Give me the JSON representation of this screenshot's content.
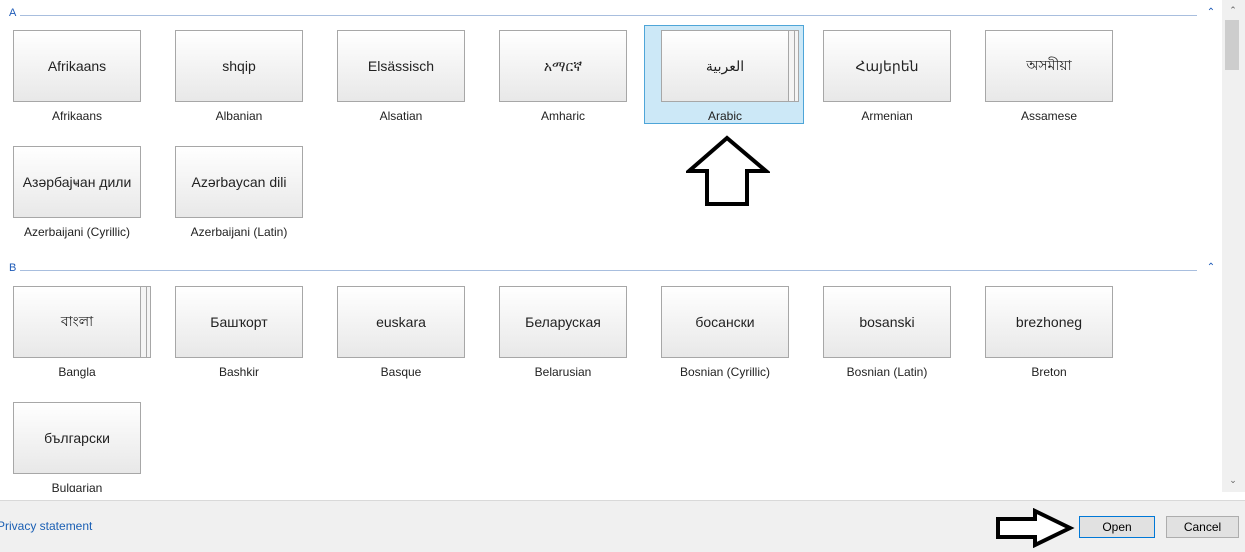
{
  "groups": [
    {
      "letter": "A",
      "chevron": "⌃",
      "chevron_icon": "chevron-up-icon",
      "items": [
        {
          "native": "Afrikaans",
          "name": "Afrikaans"
        },
        {
          "native": "shqip",
          "name": "Albanian"
        },
        {
          "native": "Elsässisch",
          "name": "Alsatian"
        },
        {
          "native": "አማርኛ",
          "name": "Amharic"
        },
        {
          "native": "العربية",
          "name": "Arabic",
          "selected": true
        },
        {
          "native": "Հայերեն",
          "name": "Armenian"
        },
        {
          "native": "অসমীয়া",
          "name": "Assamese"
        },
        {
          "native": "Азәрбајҹан дили",
          "name": "Azerbaijani (Cyrillic)"
        },
        {
          "native": "Azərbaycan dili",
          "name": "Azerbaijani (Latin)"
        }
      ]
    },
    {
      "letter": "B",
      "chevron": "⌃",
      "chevron_icon": "chevron-up-icon",
      "items": [
        {
          "native": "বাংলা",
          "name": "Bangla"
        },
        {
          "native": "Башҡорт",
          "name": "Bashkir"
        },
        {
          "native": "euskara",
          "name": "Basque"
        },
        {
          "native": "Беларуская",
          "name": "Belarusian"
        },
        {
          "native": "босански",
          "name": "Bosnian (Cyrillic)"
        },
        {
          "native": "bosanski",
          "name": "Bosnian (Latin)"
        },
        {
          "native": "brezhoneg",
          "name": "Breton"
        },
        {
          "native": "български",
          "name": "Bulgarian"
        }
      ]
    }
  ],
  "footer": {
    "privacy_link": "Privacy statement",
    "open_label": "Open",
    "cancel_label": "Cancel"
  },
  "scrollbar": {
    "up_icon": "▲",
    "down_icon": "▼"
  },
  "colors": {
    "accent": "#1e5bb8",
    "selection_bg": "#cce8f7",
    "selection_border": "#4ea5d8"
  }
}
